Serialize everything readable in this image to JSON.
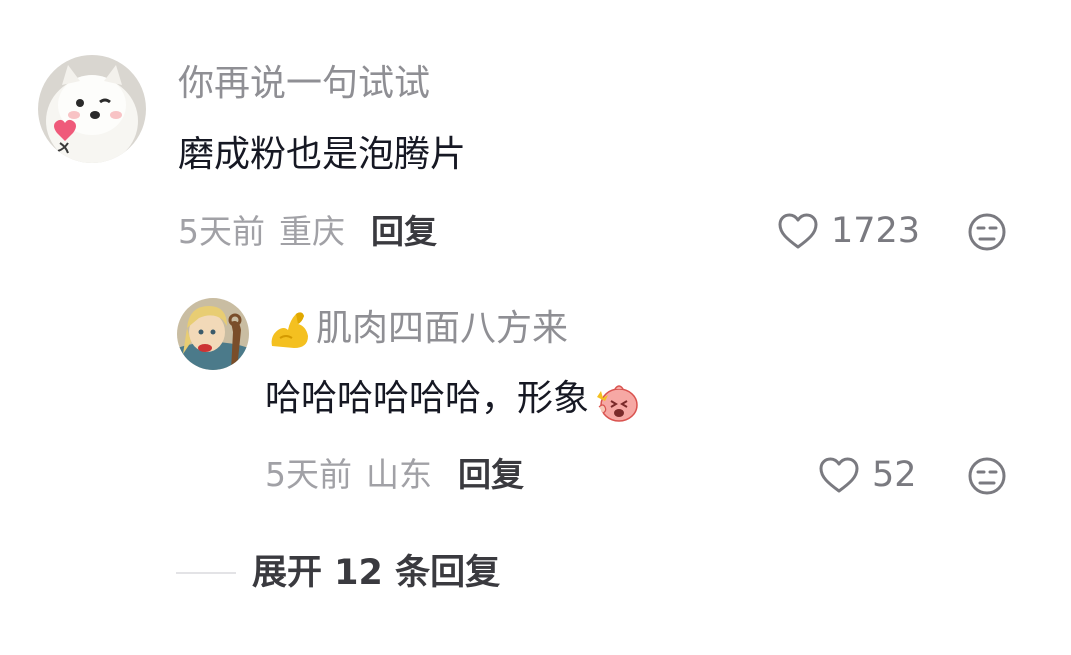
{
  "comment": {
    "username": "你再说一句试试",
    "text": "磨成粉也是泡腾片",
    "time": "5天前",
    "location": "重庆",
    "reply_label": "回复",
    "like_count": "1723"
  },
  "reply": {
    "username": "肌肉四面八方来",
    "name_emoji": "flexed-biceps-emoji",
    "text": "哈哈哈哈哈哈，形象",
    "text_emoji": "laughing-sticker-emoji",
    "time": "5天前",
    "location": "山东",
    "reply_label": "回复",
    "like_count": "52"
  },
  "expand": {
    "label": "展开 12 条回复"
  },
  "colors": {
    "text_primary": "#161823",
    "text_secondary": "#8f8f94",
    "meta_grey": "#a1a1a6",
    "icon_grey": "#7a7a80",
    "divider": "#e3e3e6"
  }
}
